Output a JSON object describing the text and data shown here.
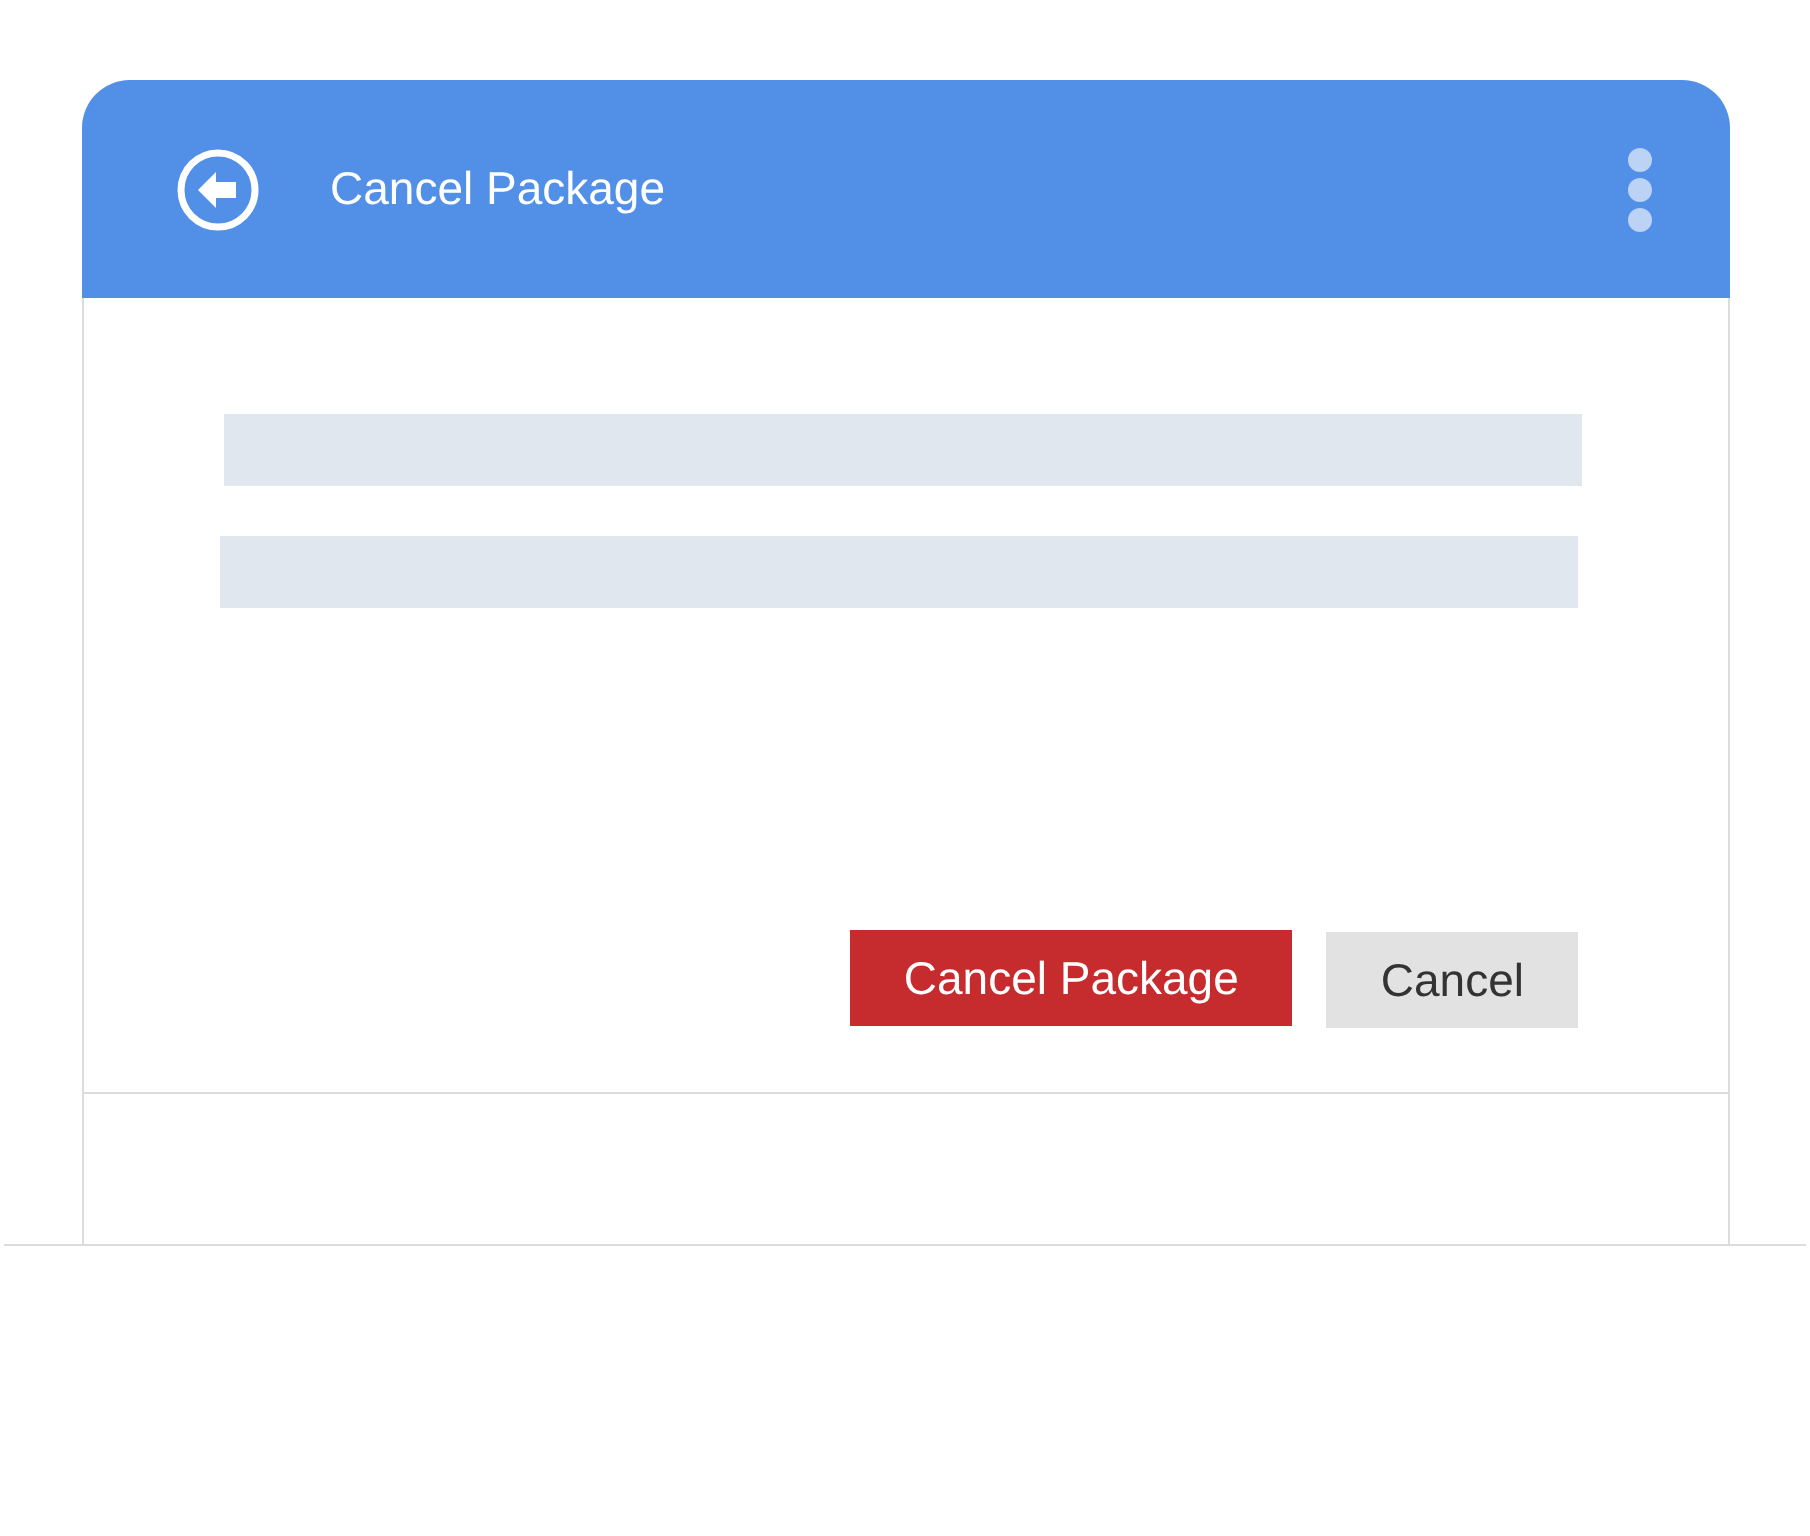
{
  "header": {
    "title": "Cancel Package"
  },
  "actions": [
    {
      "label": "Cancel Package",
      "kind": "danger"
    },
    {
      "label": "Cancel",
      "kind": "secondary"
    }
  ]
}
